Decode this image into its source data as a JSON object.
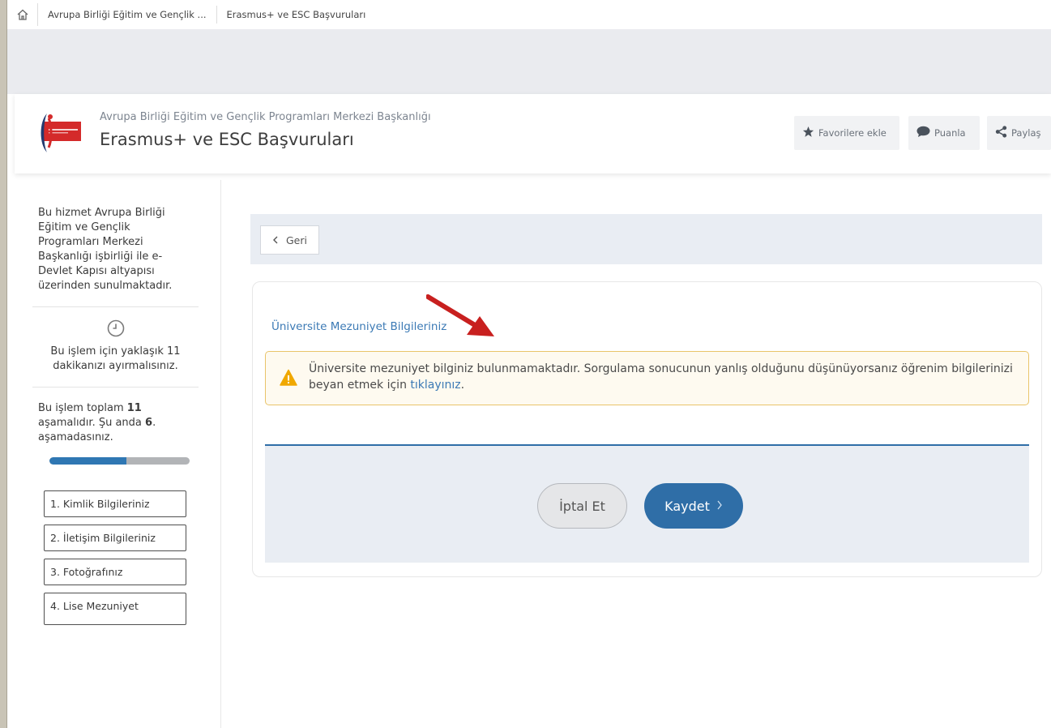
{
  "breadcrumb": {
    "home_icon": "home-icon",
    "items": [
      "Avrupa Birliği Eğitim ve Gençlik ...",
      "Erasmus+ ve ESC Başvuruları"
    ]
  },
  "header": {
    "subtitle": "Avrupa Birliği Eğitim ve Gençlik Programları Merkezi Başkanlığı",
    "title": "Erasmus+ ve ESC Başvuruları",
    "buttons": {
      "favorite": "Favorilere ekle",
      "rate": "Puanla",
      "share": "Paylaş"
    }
  },
  "sidebar": {
    "info": "Bu hizmet Avrupa Birliği Eğitim ve Gençlik Programları Merkezi Başkanlığı işbirliği ile e-Devlet Kapısı altyapısı üzerinden sunulmaktadır.",
    "time_note": "Bu işlem için yaklaşık 11 dakikanızı ayırmalısınız.",
    "progress": {
      "prefix": "Bu işlem toplam ",
      "total": "11",
      "middle": " aşamalıdır. Şu anda ",
      "current": "6",
      "suffix": ". aşamadasınız.",
      "fraction": 0.55
    },
    "steps": [
      "1. Kimlik Bilgileriniz",
      "2. İletişim Bilgileriniz",
      "3. Fotoğrafınız",
      "4. Lise Mezuniyet"
    ]
  },
  "main": {
    "back_label": "Geri",
    "section_title": "Üniversite Mezuniyet Bilgileriniz",
    "alert": {
      "text": "Üniversite mezuniyet bilginiz bulunmamaktadır. Sorgulama sonucunun yanlış olduğunu düşünüyorsanız öğrenim bilgilerinizi beyan etmek için ",
      "link": "tıklayınız",
      "end": "."
    },
    "cancel_label": "İptal Et",
    "save_label": "Kaydet"
  },
  "colors": {
    "primary": "#2f6ea7",
    "link": "#3c7ab5",
    "warning_border": "#e9c46a",
    "warning_icon": "#f0a800",
    "annotation_arrow": "#c8201f"
  }
}
